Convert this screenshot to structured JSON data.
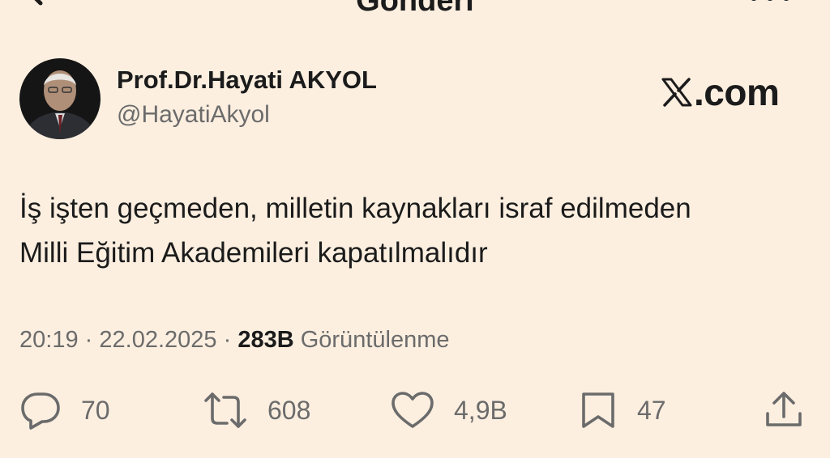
{
  "header": {
    "title": "Gönderi"
  },
  "author": {
    "name": "Prof.Dr.Hayati AKYOL",
    "handle": "@HayatiAkyol"
  },
  "watermark": {
    "text": ".com"
  },
  "post": {
    "line1": "İş işten geçmeden, milletin kaynakları israf edilmeden",
    "line2": "Milli Eğitim Akademileri kapatılmalıdır"
  },
  "meta": {
    "time": "20:19",
    "separator": "·",
    "date": "22.02.2025",
    "views_count": "283B",
    "views_label": "Görüntülenme"
  },
  "actions": {
    "replies": "70",
    "reposts": "608",
    "likes": "4,9B",
    "bookmarks": "47"
  },
  "icons": {
    "back": "arrow-left-icon",
    "more": "more-dots-icon",
    "reply": "comment-icon",
    "repost": "repost-icon",
    "like": "heart-icon",
    "bookmark": "bookmark-icon",
    "share": "share-icon"
  },
  "colors": {
    "background": "#fcefe0",
    "text": "#1b1b1b",
    "muted": "#6b6b6b"
  }
}
